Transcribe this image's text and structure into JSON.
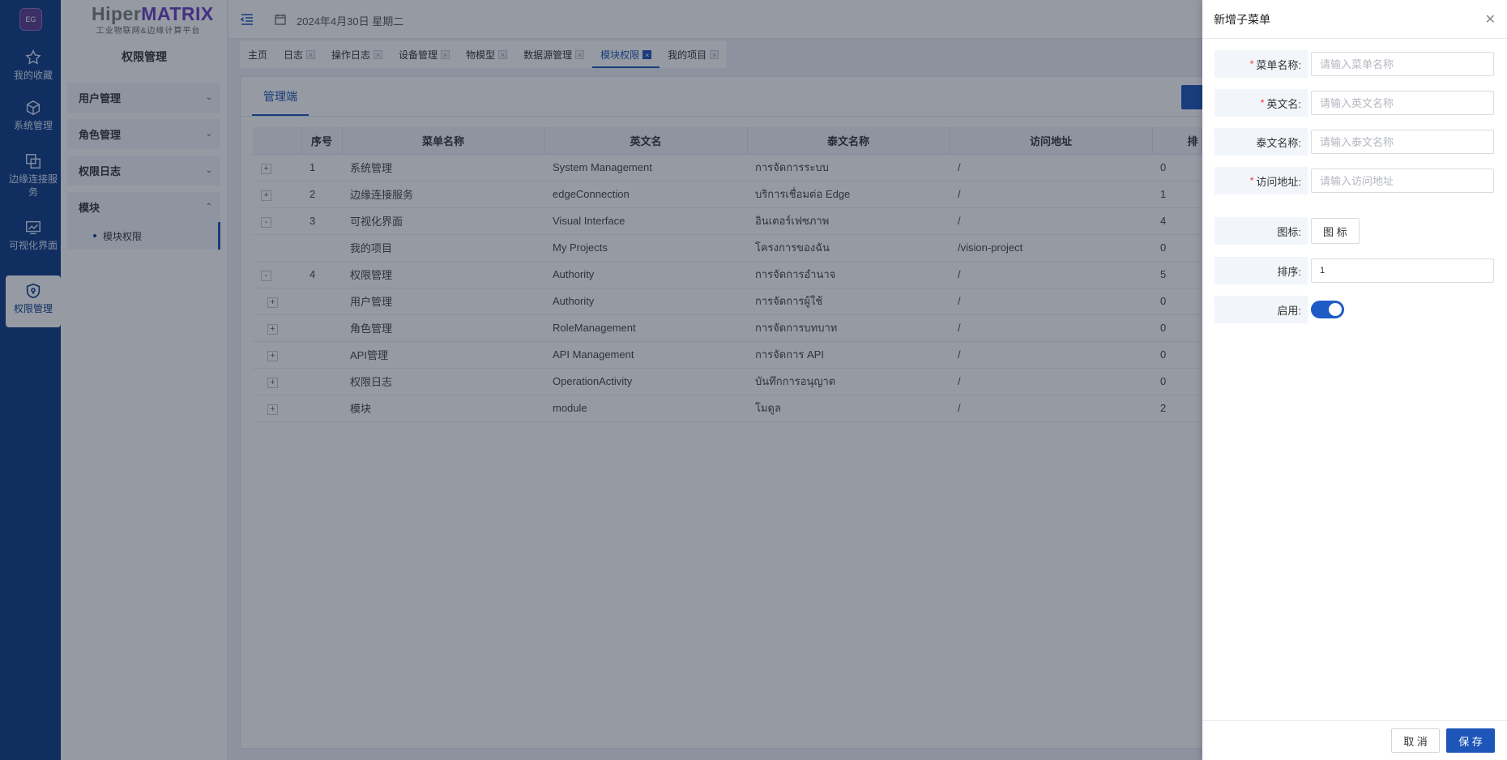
{
  "colors": {
    "primary": "#1e55b8",
    "rail": "#0d3b85",
    "brand_purple": "#6a3fc2"
  },
  "rail": {
    "logo": "EG",
    "items": [
      {
        "label": "我的收藏",
        "icon": "star-icon"
      },
      {
        "label": "系统管理",
        "icon": "cube-icon"
      },
      {
        "label": "边缘连接服务",
        "icon": "copy-icon"
      },
      {
        "label": "可视化界面",
        "icon": "monitor-chart-icon"
      },
      {
        "label": "权限管理",
        "icon": "shield-icon"
      }
    ]
  },
  "brand": {
    "name_gray": "Hiper",
    "name_purple": "MATRIX",
    "subtitle": "工业物联网&边缘计算平台"
  },
  "sidebar": {
    "title": "权限管理",
    "groups": [
      {
        "label": "用户管理"
      },
      {
        "label": "角色管理"
      },
      {
        "label": "权限日志"
      },
      {
        "label": "模块"
      }
    ],
    "active_sub": "模块权限"
  },
  "topbar": {
    "date": "2024年4月30日 星期二"
  },
  "tabs": [
    "主页",
    "日志",
    "操作日志",
    "设备管理",
    "物模型",
    "数据源管理",
    "模块权限",
    "我的项目"
  ],
  "content": {
    "subtab": "管理端",
    "table": {
      "headers": [
        "",
        "序号",
        "菜单名称",
        "英文名",
        "泰文名称",
        "访问地址",
        "排"
      ],
      "rows": [
        {
          "exp": "+",
          "seq": "1",
          "name": "系统管理",
          "en": "System Management",
          "th": "การจัดการระบบ",
          "url": "/",
          "sort": "0"
        },
        {
          "exp": "+",
          "seq": "2",
          "name": "边缘连接服务",
          "en": "edgeConnection",
          "th": "บริการเชื่อมต่อ Edge",
          "url": "/",
          "sort": "1"
        },
        {
          "exp": "-",
          "seq": "3",
          "name": "可视化界面",
          "en": "Visual Interface",
          "th": "อินเตอร์เฟซภาพ",
          "url": "/",
          "sort": "4"
        },
        {
          "exp": "",
          "seq": "",
          "name": "我的项目",
          "en": "My Projects",
          "th": "โครงการของฉัน",
          "url": "/vision-project",
          "sort": "0"
        },
        {
          "exp": "-",
          "seq": "4",
          "name": "权限管理",
          "en": "Authority",
          "th": "การจัดการอำนาจ",
          "url": "/",
          "sort": "5"
        },
        {
          "exp": "+",
          "seq": "",
          "name": "用户管理",
          "en": "Authority",
          "th": "การจัดการผู้ใช้",
          "url": "/",
          "sort": "0"
        },
        {
          "exp": "+",
          "seq": "",
          "name": "角色管理",
          "en": "RoleManagement",
          "th": "การจัดการบทบาท",
          "url": "/",
          "sort": "0"
        },
        {
          "exp": "+",
          "seq": "",
          "name": "API管理",
          "en": "API Management",
          "th": "การจัดการ API",
          "url": "/",
          "sort": "0"
        },
        {
          "exp": "+",
          "seq": "",
          "name": "权限日志",
          "en": "OperationActivity",
          "th": "บันทึกการอนุญาต",
          "url": "/",
          "sort": "0"
        },
        {
          "exp": "+",
          "seq": "",
          "name": "模块",
          "en": "module",
          "th": "โมดูล",
          "url": "/",
          "sort": "2"
        }
      ]
    }
  },
  "drawer": {
    "title": "新增子菜单",
    "fields": {
      "menu_name": {
        "label": "菜单名称:",
        "placeholder": "请输入菜单名称",
        "required": true
      },
      "en_name": {
        "label": "英文名:",
        "placeholder": "请输入英文名称",
        "required": true
      },
      "th_name": {
        "label": "泰文名称:",
        "placeholder": "请输入泰文名称",
        "required": false
      },
      "url": {
        "label": "访问地址:",
        "placeholder": "请输入访问地址",
        "required": true
      },
      "icon": {
        "label": "图标:",
        "button": "图 标"
      },
      "sort": {
        "label": "排序:",
        "value": "1"
      },
      "enabled": {
        "label": "启用:",
        "value": true
      }
    },
    "cancel": "取 消",
    "save": "保 存"
  }
}
